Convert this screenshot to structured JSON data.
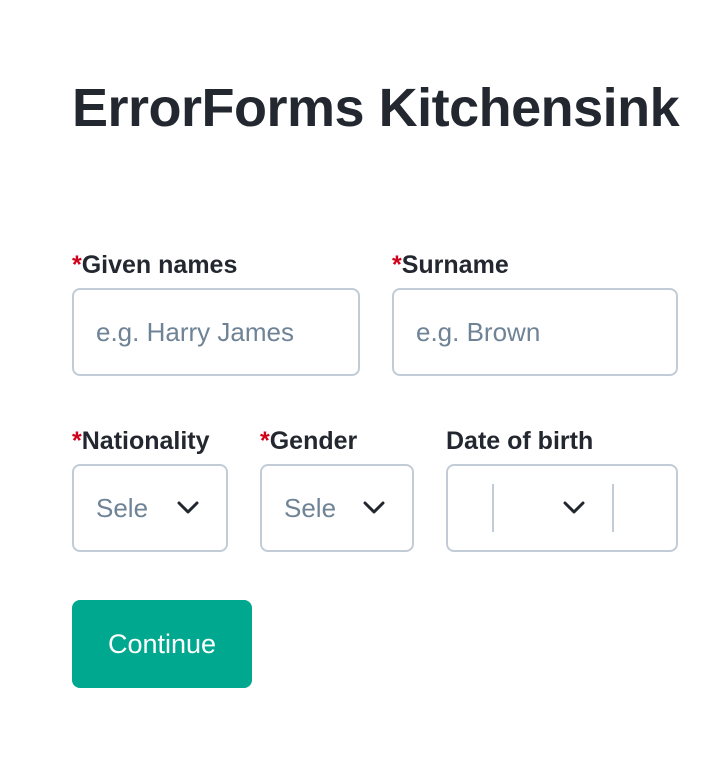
{
  "page": {
    "title": "ErrorForms Kitchensink"
  },
  "form": {
    "required_marker": "*",
    "given_names": {
      "label": "Given names",
      "placeholder": "e.g. Harry James",
      "value": ""
    },
    "surname": {
      "label": "Surname",
      "placeholder": "e.g. Brown",
      "value": ""
    },
    "nationality": {
      "label": "Nationality",
      "selected": "Sele"
    },
    "gender": {
      "label": "Gender",
      "selected": "Sele"
    },
    "date_of_birth": {
      "label": "Date of birth",
      "day": "",
      "month": "",
      "year": ""
    },
    "continue_label": "Continue"
  },
  "icons": {
    "select_chevron": "chevron-down-icon"
  },
  "colors": {
    "primary_button": "#00a88f",
    "required": "#d0021b",
    "border": "#c2ccd6",
    "placeholder": "#6f8396",
    "text": "#23272f"
  }
}
